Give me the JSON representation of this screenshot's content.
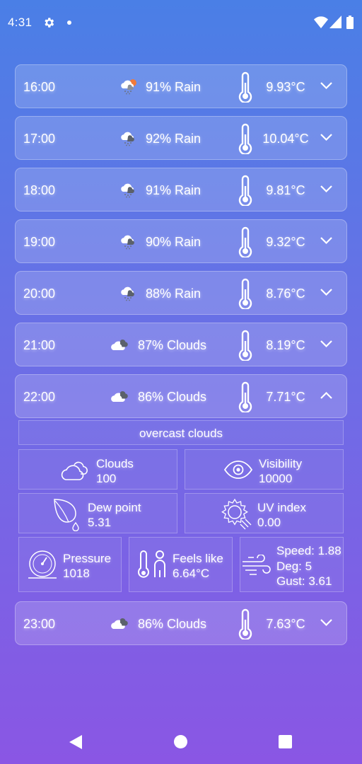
{
  "status_bar": {
    "time": "4:31",
    "icons": [
      "gear-icon",
      "notification-dot",
      "wifi-icon",
      "signal-icon",
      "battery-icon"
    ]
  },
  "forecast": [
    {
      "time": "16:00",
      "icon": "rain-sun-icon",
      "condition": "91% Rain",
      "temp": "9.93°C",
      "expanded": false
    },
    {
      "time": "17:00",
      "icon": "rain-cloud-icon",
      "condition": "92% Rain",
      "temp": "10.04°C",
      "expanded": false
    },
    {
      "time": "18:00",
      "icon": "rain-cloud-icon",
      "condition": "91% Rain",
      "temp": "9.81°C",
      "expanded": false
    },
    {
      "time": "19:00",
      "icon": "rain-cloud-icon",
      "condition": "90% Rain",
      "temp": "9.32°C",
      "expanded": false
    },
    {
      "time": "20:00",
      "icon": "rain-cloud-icon",
      "condition": "88% Rain",
      "temp": "8.76°C",
      "expanded": false
    },
    {
      "time": "21:00",
      "icon": "clouds-icon",
      "condition": "87% Clouds",
      "temp": "8.19°C",
      "expanded": false
    },
    {
      "time": "22:00",
      "icon": "clouds-icon",
      "condition": "86% Clouds",
      "temp": "7.71°C",
      "expanded": true
    },
    {
      "time": "23:00",
      "icon": "clouds-icon",
      "condition": "86% Clouds",
      "temp": "7.63°C",
      "expanded": false
    }
  ],
  "details": {
    "description": "overcast clouds",
    "clouds": {
      "label": "Clouds",
      "value": "100"
    },
    "visibility": {
      "label": "Visibility",
      "value": "10000"
    },
    "dew_point": {
      "label": "Dew point",
      "value": "5.31"
    },
    "uv_index": {
      "label": "UV index",
      "value": "0.00"
    },
    "pressure": {
      "label": "Pressure",
      "value": "1018"
    },
    "feels_like": {
      "label": "Feels like",
      "value": "6.64°C"
    },
    "wind": {
      "speed": "Speed: 1.88",
      "deg": "Deg: 5",
      "gust": "Gust: 3.61"
    }
  },
  "nav_bar": {
    "icons": [
      "back-icon",
      "home-icon",
      "recents-icon"
    ]
  }
}
